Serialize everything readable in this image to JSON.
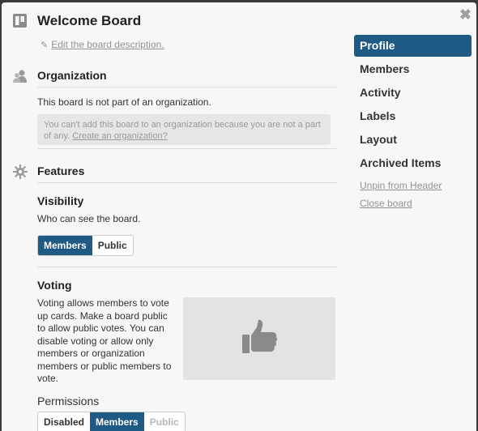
{
  "board": {
    "title": "Welcome Board",
    "edit_description": "Edit the board description.",
    "close_symbol": "✖"
  },
  "organization": {
    "heading": "Organization",
    "status": "This board is not part of an organization.",
    "note": "You can't add this board to an organization because you are not a part of any.",
    "create_link": "Create an organization?"
  },
  "features": {
    "heading": "Features",
    "visibility": {
      "heading": "Visibility",
      "description": "Who can see the board.",
      "options": [
        "Members",
        "Public"
      ],
      "selected": "Members"
    },
    "voting": {
      "heading": "Voting",
      "description": "Voting allows members to vote up cards. Make a board public to allow public votes. You can disable voting or allow only members or organization members or public members to vote.",
      "permissions_label": "Permissions",
      "options": [
        "Disabled",
        "Members",
        "Public"
      ],
      "selected": "Members",
      "image_icon": "thumbs-up-icon"
    }
  },
  "sidebar": {
    "items": [
      {
        "label": "Profile",
        "active": true
      },
      {
        "label": "Members",
        "active": false
      },
      {
        "label": "Activity",
        "active": false
      },
      {
        "label": "Labels",
        "active": false
      },
      {
        "label": "Layout",
        "active": false
      },
      {
        "label": "Archived Items",
        "active": false
      }
    ],
    "links": [
      "Unpin from Header",
      "Close board"
    ]
  },
  "colors": {
    "accent": "#1f5a84",
    "muted_text": "#939393"
  }
}
